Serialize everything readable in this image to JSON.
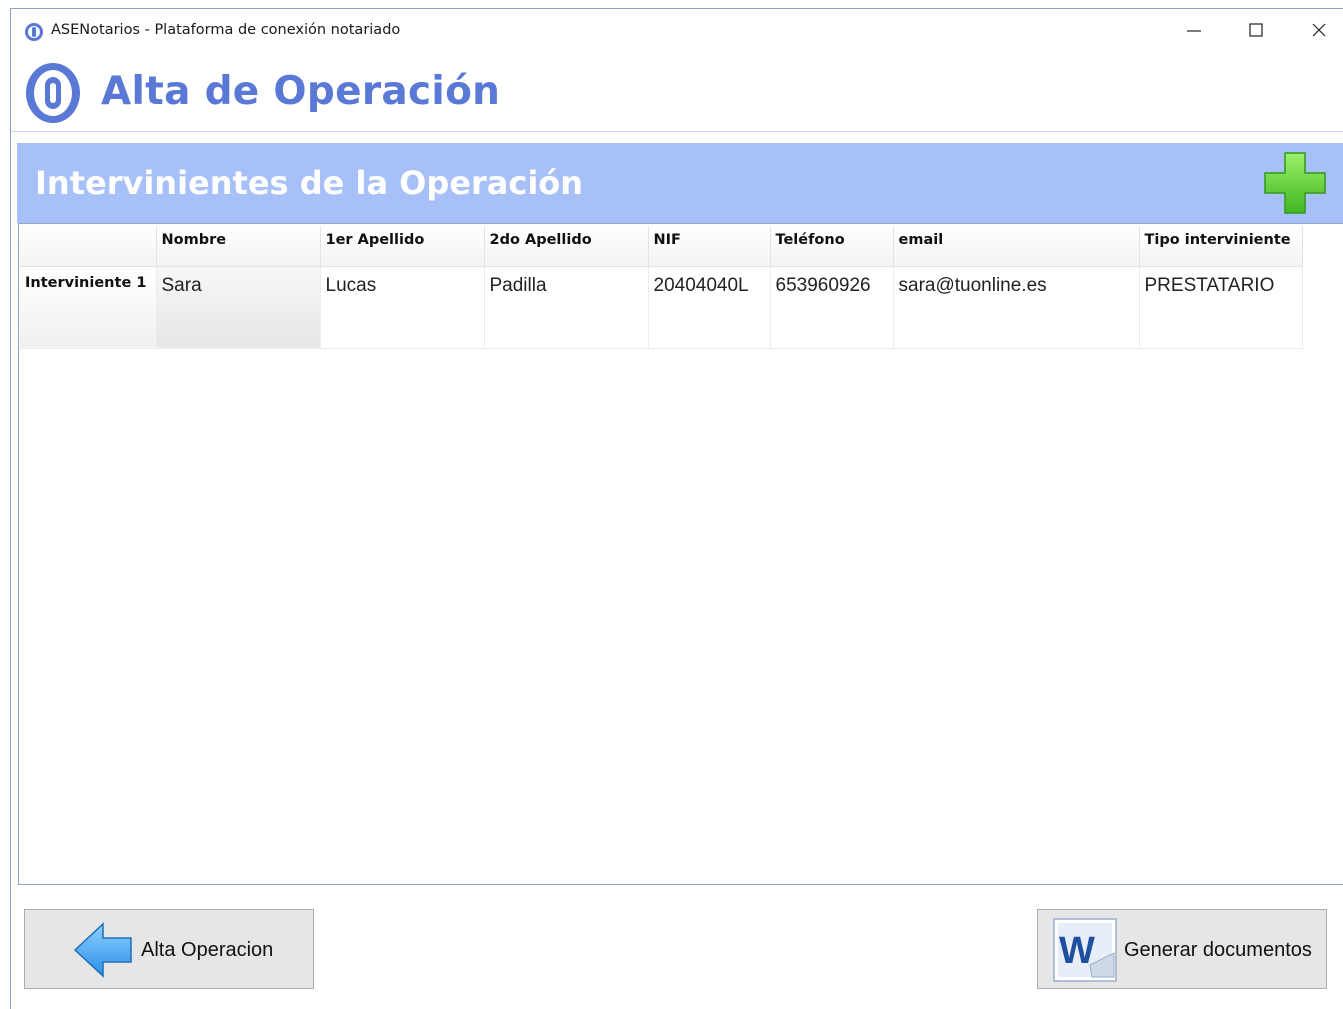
{
  "window": {
    "title": "ASENotarios - Plataforma de conexión notariado",
    "controls": [
      "minimize-icon",
      "maximize-icon",
      "close-icon"
    ]
  },
  "header": {
    "title": "Alta de Operación",
    "logo_icon": "asenotarios-logo-icon"
  },
  "section": {
    "title": "Intervinientes de la Operación",
    "add_icon": "green-plus-icon"
  },
  "grid": {
    "columns": [
      "",
      "Nombre",
      "1er Apellido",
      "2do Apellido",
      "NIF",
      "Teléfono",
      "email",
      "Tipo interviniente"
    ],
    "rows": [
      {
        "label": "Interviniente 1",
        "nombre": "Sara",
        "apellido1": "Lucas",
        "apellido2": "Padilla",
        "nif": "20404040L",
        "telefono": "653960926",
        "email": "sara@tuonline.es",
        "tipo": "PRESTATARIO"
      }
    ]
  },
  "footer": {
    "back_button_label": "Alta Operacion",
    "back_icon": "blue-left-arrow-icon",
    "generate_button_label": "Generar documentos",
    "generate_icon": "word-document-icon"
  },
  "colors": {
    "title_blue": "#5a78d6",
    "banner_blue": "#a7c0f7",
    "plus_green": "#5fd23c"
  }
}
